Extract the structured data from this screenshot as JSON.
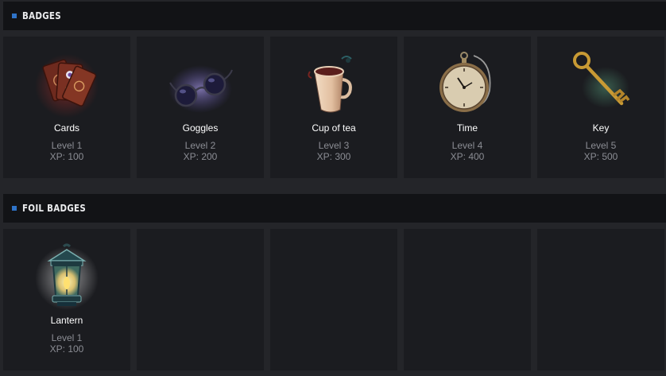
{
  "badges_section": {
    "title": "BADGES",
    "items": [
      {
        "name": "Cards",
        "level": "Level 1",
        "xp": "XP: 100",
        "icon": "cards-icon"
      },
      {
        "name": "Goggles",
        "level": "Level 2",
        "xp": "XP: 200",
        "icon": "goggles-icon"
      },
      {
        "name": "Cup of tea",
        "level": "Level 3",
        "xp": "XP: 300",
        "icon": "teacup-icon"
      },
      {
        "name": "Time",
        "level": "Level 4",
        "xp": "XP: 400",
        "icon": "pocket-watch-icon"
      },
      {
        "name": "Key",
        "level": "Level 5",
        "xp": "XP: 500",
        "icon": "key-icon"
      }
    ]
  },
  "foil_section": {
    "title": "FOIL BADGES",
    "items": [
      {
        "name": "Lantern",
        "level": "Level 1",
        "xp": "XP: 100",
        "icon": "lantern-icon"
      }
    ]
  },
  "colors": {
    "page_background": "#242529",
    "header_background": "#121316",
    "card_background": "#1b1c20",
    "accent_marker": "#2f73c8",
    "name_text": "#ffffff",
    "meta_text": "#8b8d94"
  }
}
